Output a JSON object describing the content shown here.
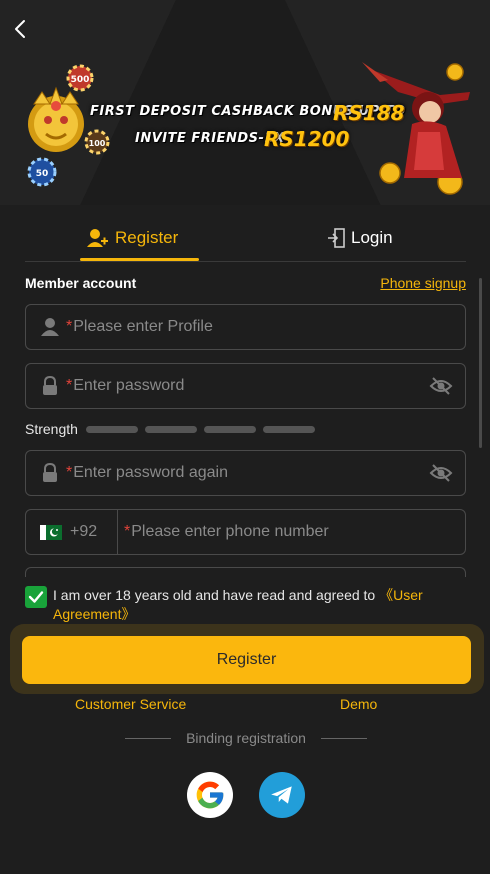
{
  "banner": {
    "line1": "FIRST DEPOSIT CASHBACK BONUS UP TO",
    "amount1": "RS188",
    "line2": "INVITE FRIENDS-1X",
    "amount2": "RS1200",
    "chips": [
      "500",
      "100",
      "50"
    ]
  },
  "tabs": {
    "register": "Register",
    "login": "Login",
    "active": "register"
  },
  "form": {
    "member_label": "Member account",
    "phone_signup": "Phone signup",
    "required_mark": "*",
    "profile_placeholder": "Please enter Profile",
    "password_placeholder": "Enter password",
    "strength_label": "Strength",
    "confirm_placeholder": "Enter password again",
    "country_code": "+92",
    "phone_placeholder": "Please enter phone number"
  },
  "agreement": {
    "checked": true,
    "text": "I am over 18 years old and have read and agreed to ",
    "link": "《User Agreement》"
  },
  "actions": {
    "register_button": "Register",
    "customer_service": "Customer Service",
    "demo": "Demo",
    "binding": "Binding registration"
  },
  "colors": {
    "accent": "#f5b60b",
    "button": "#fbb70d",
    "check": "#19a33a",
    "required": "#e0443a",
    "background": "#1e1e1e"
  },
  "icons": {
    "back": "chevron-left-icon",
    "register_tab": "user-plus-icon",
    "login_tab": "door-enter-icon",
    "profile": "user-icon",
    "password": "lock-icon",
    "visibility": "eye-off-icon",
    "flag": "pakistan-flag-icon",
    "google": "google-icon",
    "telegram": "telegram-icon"
  }
}
